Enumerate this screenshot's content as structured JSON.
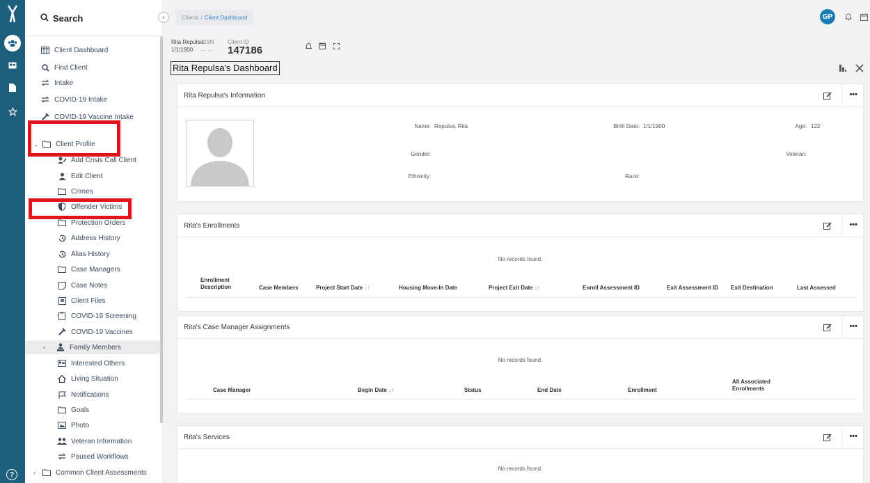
{
  "sidebar": {
    "search_label": "Search",
    "items": [
      {
        "label": "Client Dashboard",
        "icon": "columns-icon"
      },
      {
        "label": "Find Client",
        "icon": "search-icon"
      },
      {
        "label": "Intake",
        "icon": "workflow-icon"
      },
      {
        "label": "COVID-19 Intake",
        "icon": "workflow-icon"
      },
      {
        "label": "COVID-19 Vaccine Intake",
        "icon": "syringe-icon"
      },
      {
        "label": "Client Profile",
        "icon": "folder-icon"
      },
      {
        "label": "Add Crisis Call Client",
        "icon": "user-edit-icon"
      },
      {
        "label": "Edit Client",
        "icon": "user-icon"
      },
      {
        "label": "Crimes",
        "icon": "folder-icon"
      },
      {
        "label": "Offender Victims",
        "icon": "shield-icon"
      },
      {
        "label": "Protection Orders",
        "icon": "folder-icon"
      },
      {
        "label": "Address History",
        "icon": "history-icon"
      },
      {
        "label": "Alias History",
        "icon": "history-icon"
      },
      {
        "label": "Case Managers",
        "icon": "folder-icon"
      },
      {
        "label": "Case Notes",
        "icon": "note-icon"
      },
      {
        "label": "Client Files",
        "icon": "file-icon"
      },
      {
        "label": "COVID-19 Screening",
        "icon": "clipboard-icon"
      },
      {
        "label": "COVID-19 Vaccines",
        "icon": "syringe-icon"
      },
      {
        "label": "Family Members",
        "icon": "family-icon"
      },
      {
        "label": "Interested Others",
        "icon": "id-card-icon"
      },
      {
        "label": "Living Situation",
        "icon": "home-icon"
      },
      {
        "label": "Notifications",
        "icon": "flag-icon"
      },
      {
        "label": "Goals",
        "icon": "folder-icon"
      },
      {
        "label": "Photo",
        "icon": "image-icon"
      },
      {
        "label": "Veteran Information",
        "icon": "users-icon"
      },
      {
        "label": "Paused Workflows",
        "icon": "workflow-icon"
      },
      {
        "label": "Common Client Assessments",
        "icon": "folder-icon"
      }
    ]
  },
  "breadcrumb": {
    "root": "Clients",
    "separator": "/",
    "current": "Client Dashboard"
  },
  "user": {
    "initials": "GP"
  },
  "client": {
    "name": "Rita Repulsa",
    "dob": "1/1/1900",
    "ssn_label": "SSN",
    "ssn_value": "-- --",
    "id_label": "Client ID",
    "id_value": "147186"
  },
  "dashboard_title": "Rita Repulsa's Dashboard",
  "info_panel": {
    "title": "Rita Repulsa's Information",
    "name_label": "Name:",
    "name_value": "Repulsa, Rita",
    "birth_label": "Birth Date:",
    "birth_value": "1/1/1900",
    "age_label": "Age:",
    "age_value": "122",
    "gender_label": "Gender:",
    "veteran_label": "Veteran:",
    "ethnicity_label": "Ethnicity:",
    "race_label": "Race:"
  },
  "enrollments": {
    "title": "Rita's Enrollments",
    "empty": "No records found.",
    "columns": [
      "Enrollment",
      "Description",
      "Case Members",
      "Project Start Date",
      "Housing Move-In Date",
      "Project Exit Date",
      "Enroll Assessment ID",
      "Exit Assessment ID",
      "Exit Destination",
      "Last Assessed"
    ]
  },
  "case_managers": {
    "title": "Rita's Case Manager Assignments",
    "empty": "No records found.",
    "columns": [
      "Case Manager",
      "Begin Date",
      "Status",
      "End Date",
      "Enrollment",
      "All Associated",
      "Enrollments"
    ]
  },
  "services": {
    "title": "Rita's Services",
    "empty": "No records found."
  },
  "more_label": "•••",
  "sort_glyph": "↓↑",
  "colors": {
    "rail": "#1d5f7c",
    "accent": "#1d7db3",
    "highlight": "#e0141b"
  }
}
